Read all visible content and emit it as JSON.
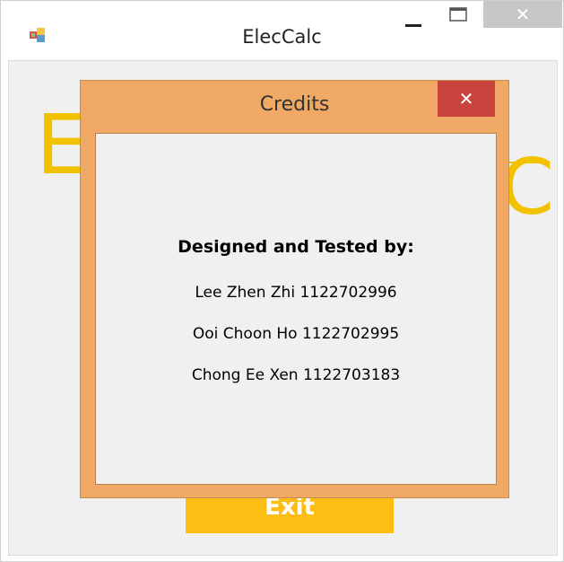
{
  "window": {
    "title": "ElecCalc",
    "minimize_glyph": "—",
    "maximize_glyph": "☐",
    "close_glyph": "✕"
  },
  "logo": {
    "left_letter": "E",
    "right_letter": "C",
    "color": "#f2c200"
  },
  "main": {
    "exit_label": "Exit"
  },
  "credits_dialog": {
    "title": "Credits",
    "close_glyph": "✕",
    "heading": "Designed and Tested by:",
    "people": [
      "Lee Zhen Zhi 1122702996",
      "Ooi Choon Ho 1122702995",
      "Chong Ee Xen 1122703183"
    ],
    "frame_color": "#f0a865",
    "close_color": "#c9433d"
  }
}
